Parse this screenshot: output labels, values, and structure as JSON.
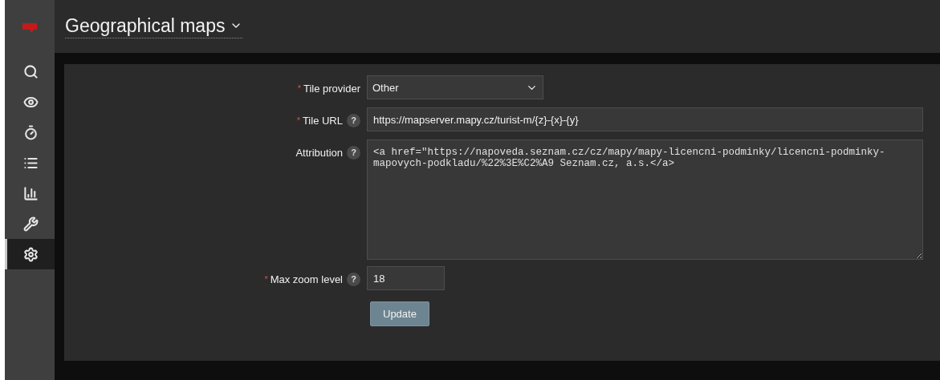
{
  "sidebar": {
    "items": [
      {
        "kind": "search",
        "selected": false
      },
      {
        "kind": "eye",
        "selected": false
      },
      {
        "kind": "timer",
        "selected": false
      },
      {
        "kind": "list",
        "selected": false
      },
      {
        "kind": "chart",
        "selected": false
      },
      {
        "kind": "wrench",
        "selected": false
      },
      {
        "kind": "gear",
        "selected": true
      }
    ]
  },
  "header": {
    "title": "Geographical maps"
  },
  "form": {
    "rows": [
      {
        "kind": "select",
        "label": "Tile provider",
        "required_mark": "*",
        "value": "Other"
      },
      {
        "kind": "text",
        "label": "Tile URL",
        "required_mark": "*",
        "help": "?",
        "value": "https://mapserver.mapy.cz/turist-m/{z}-{x}-{y}"
      },
      {
        "kind": "textarea",
        "label": "Attribution",
        "help": "?",
        "value": "<a href=\"https://napoveda.seznam.cz/cz/mapy/mapy-licencni-podminky/licencni-podminky-mapovych-podkladu/%22%3E%C2%A9 Seznam.cz, a.s.</a>"
      },
      {
        "kind": "number",
        "label": "Max zoom level",
        "required_mark": "*",
        "help": "?",
        "value": "18"
      }
    ],
    "button": "Update"
  }
}
